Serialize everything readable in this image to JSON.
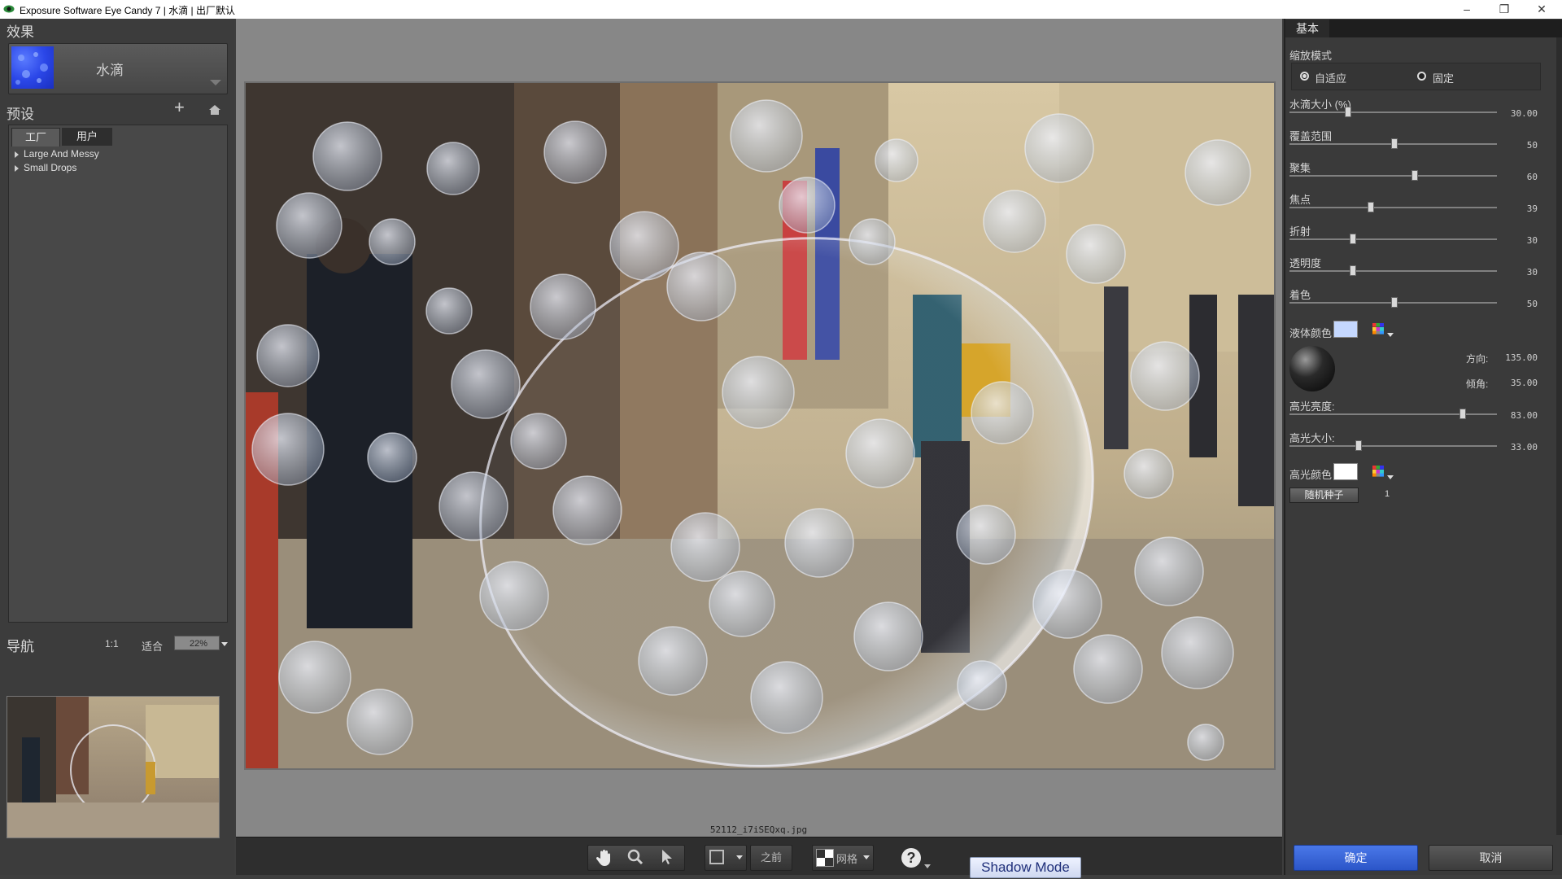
{
  "window": {
    "title": "Exposure Software Eye Candy 7 | 水滴 | 出厂默认",
    "controls": [
      "–",
      "❐",
      "✕"
    ]
  },
  "effect": {
    "section_title": "效果",
    "name": "水滴"
  },
  "presets": {
    "section_title": "预设",
    "tabs": [
      "工厂",
      "用户"
    ],
    "items": [
      "Large And Messy",
      "Small Drops"
    ]
  },
  "navigation": {
    "section_title": "导航",
    "one_to_one": "1:1",
    "fit": "适合",
    "zoom": "22%"
  },
  "canvas": {
    "filename": "52112_i7iSEQxq.jpg"
  },
  "toolbar": {
    "before_label": "之前",
    "grid_label": "网格",
    "shadow_mode_label": "Shadow Mode"
  },
  "right_panel": {
    "tab": "基本",
    "zoom_mode_label": "缩放模式",
    "zoom_modes": [
      "自适应",
      "固定"
    ],
    "sliders": [
      {
        "label": "水滴大小 (%)",
        "value": "30.00",
        "fraction": 0.28
      },
      {
        "label": "覆盖范围",
        "value": "50",
        "fraction": 0.5
      },
      {
        "label": "聚集",
        "value": "60",
        "fraction": 0.6
      },
      {
        "label": "焦点",
        "value": "39",
        "fraction": 0.39
      },
      {
        "label": "折射",
        "value": "30",
        "fraction": 0.3
      },
      {
        "label": "透明度",
        "value": "30",
        "fraction": 0.3
      },
      {
        "label": "着色",
        "value": "50",
        "fraction": 0.5
      }
    ],
    "liquid_color_label": "液体颜色",
    "liquid_color": "#c5d8ff",
    "direction_label": "方向:",
    "direction_value": "135.00",
    "inclination_label": "倾角:",
    "inclination_value": "35.00",
    "sliders2": [
      {
        "label": "高光亮度:",
        "value": "83.00",
        "fraction": 0.83
      },
      {
        "label": "高光大小:",
        "value": "33.00",
        "fraction": 0.33
      }
    ],
    "highlight_color_label": "高光颜色",
    "highlight_color": "#ffffff",
    "random_seed_label": "随机种子",
    "random_seed_value": "1"
  },
  "buttons": {
    "ok": "确定",
    "cancel": "取消"
  },
  "colors": {
    "accent": "#2b55c8",
    "panel": "#3a3a3a"
  }
}
